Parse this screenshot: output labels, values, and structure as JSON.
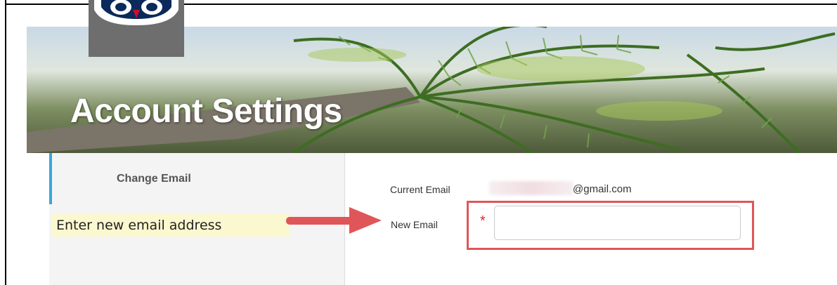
{
  "header": {
    "title": "Account Settings",
    "logo_icon": "owl-logo-icon"
  },
  "sidebar": {
    "items": [
      {
        "label": "Change Email",
        "active": true
      }
    ]
  },
  "annotation": {
    "callout_text": "Enter new email address",
    "arrow_icon": "red-arrow-right-icon",
    "highlight_color": "#e05658"
  },
  "form": {
    "current_email_label": "Current Email",
    "current_email_domain": "@gmail.com",
    "new_email_label": "New Email",
    "required_marker": "*",
    "new_email_value": "",
    "new_email_placeholder": ""
  },
  "colors": {
    "accent": "#3aa6d9",
    "required": "#d62828",
    "callout_bg": "#fbf8cf"
  }
}
